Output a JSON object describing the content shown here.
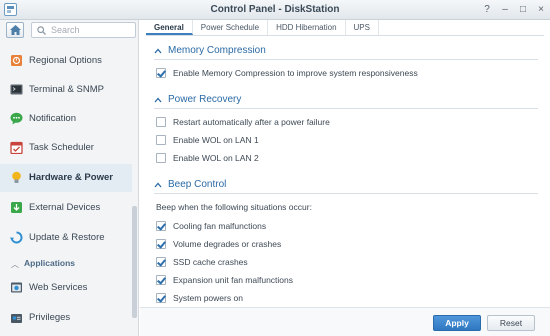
{
  "window": {
    "title": "Control Panel - DiskStation"
  },
  "search": {
    "placeholder": "Search"
  },
  "sidebar": {
    "items": [
      {
        "label": "Regional Options",
        "icon": "regional-options-icon"
      },
      {
        "label": "Terminal & SNMP",
        "icon": "terminal-icon"
      },
      {
        "label": "Notification",
        "icon": "notification-icon"
      },
      {
        "label": "Task Scheduler",
        "icon": "task-scheduler-icon"
      },
      {
        "label": "Hardware & Power",
        "icon": "lightbulb-icon",
        "active": true
      },
      {
        "label": "External Devices",
        "icon": "external-devices-icon"
      },
      {
        "label": "Update & Restore",
        "icon": "update-restore-icon"
      }
    ],
    "section": {
      "label": "Applications"
    },
    "app_items": [
      {
        "label": "Web Services",
        "icon": "web-services-icon"
      },
      {
        "label": "Privileges",
        "icon": "privileges-icon"
      }
    ]
  },
  "tabs": [
    {
      "label": "General",
      "active": true
    },
    {
      "label": "Power Schedule"
    },
    {
      "label": "HDD Hibernation"
    },
    {
      "label": "UPS"
    }
  ],
  "sections": {
    "memory": {
      "title": "Memory Compression",
      "options": [
        {
          "label": "Enable Memory Compression to improve system responsiveness",
          "checked": true
        }
      ]
    },
    "power": {
      "title": "Power Recovery",
      "options": [
        {
          "label": "Restart automatically after a power failure",
          "checked": false
        },
        {
          "label": "Enable WOL on LAN 1",
          "checked": false
        },
        {
          "label": "Enable WOL on LAN 2",
          "checked": false
        }
      ]
    },
    "beep": {
      "title": "Beep Control",
      "description": "Beep when the following situations occur:",
      "options": [
        {
          "label": "Cooling fan malfunctions",
          "checked": true
        },
        {
          "label": "Volume degrades or crashes",
          "checked": true
        },
        {
          "label": "SSD cache crashes",
          "checked": true
        },
        {
          "label": "Expansion unit fan malfunctions",
          "checked": true
        },
        {
          "label": "System powers on",
          "checked": true
        }
      ]
    }
  },
  "footer": {
    "apply_label": "Apply",
    "reset_label": "Reset"
  },
  "colors": {
    "accent": "#2b6aa5",
    "apply_button": "#3a86cd",
    "active_nav_bg": "#e3ebf3"
  }
}
